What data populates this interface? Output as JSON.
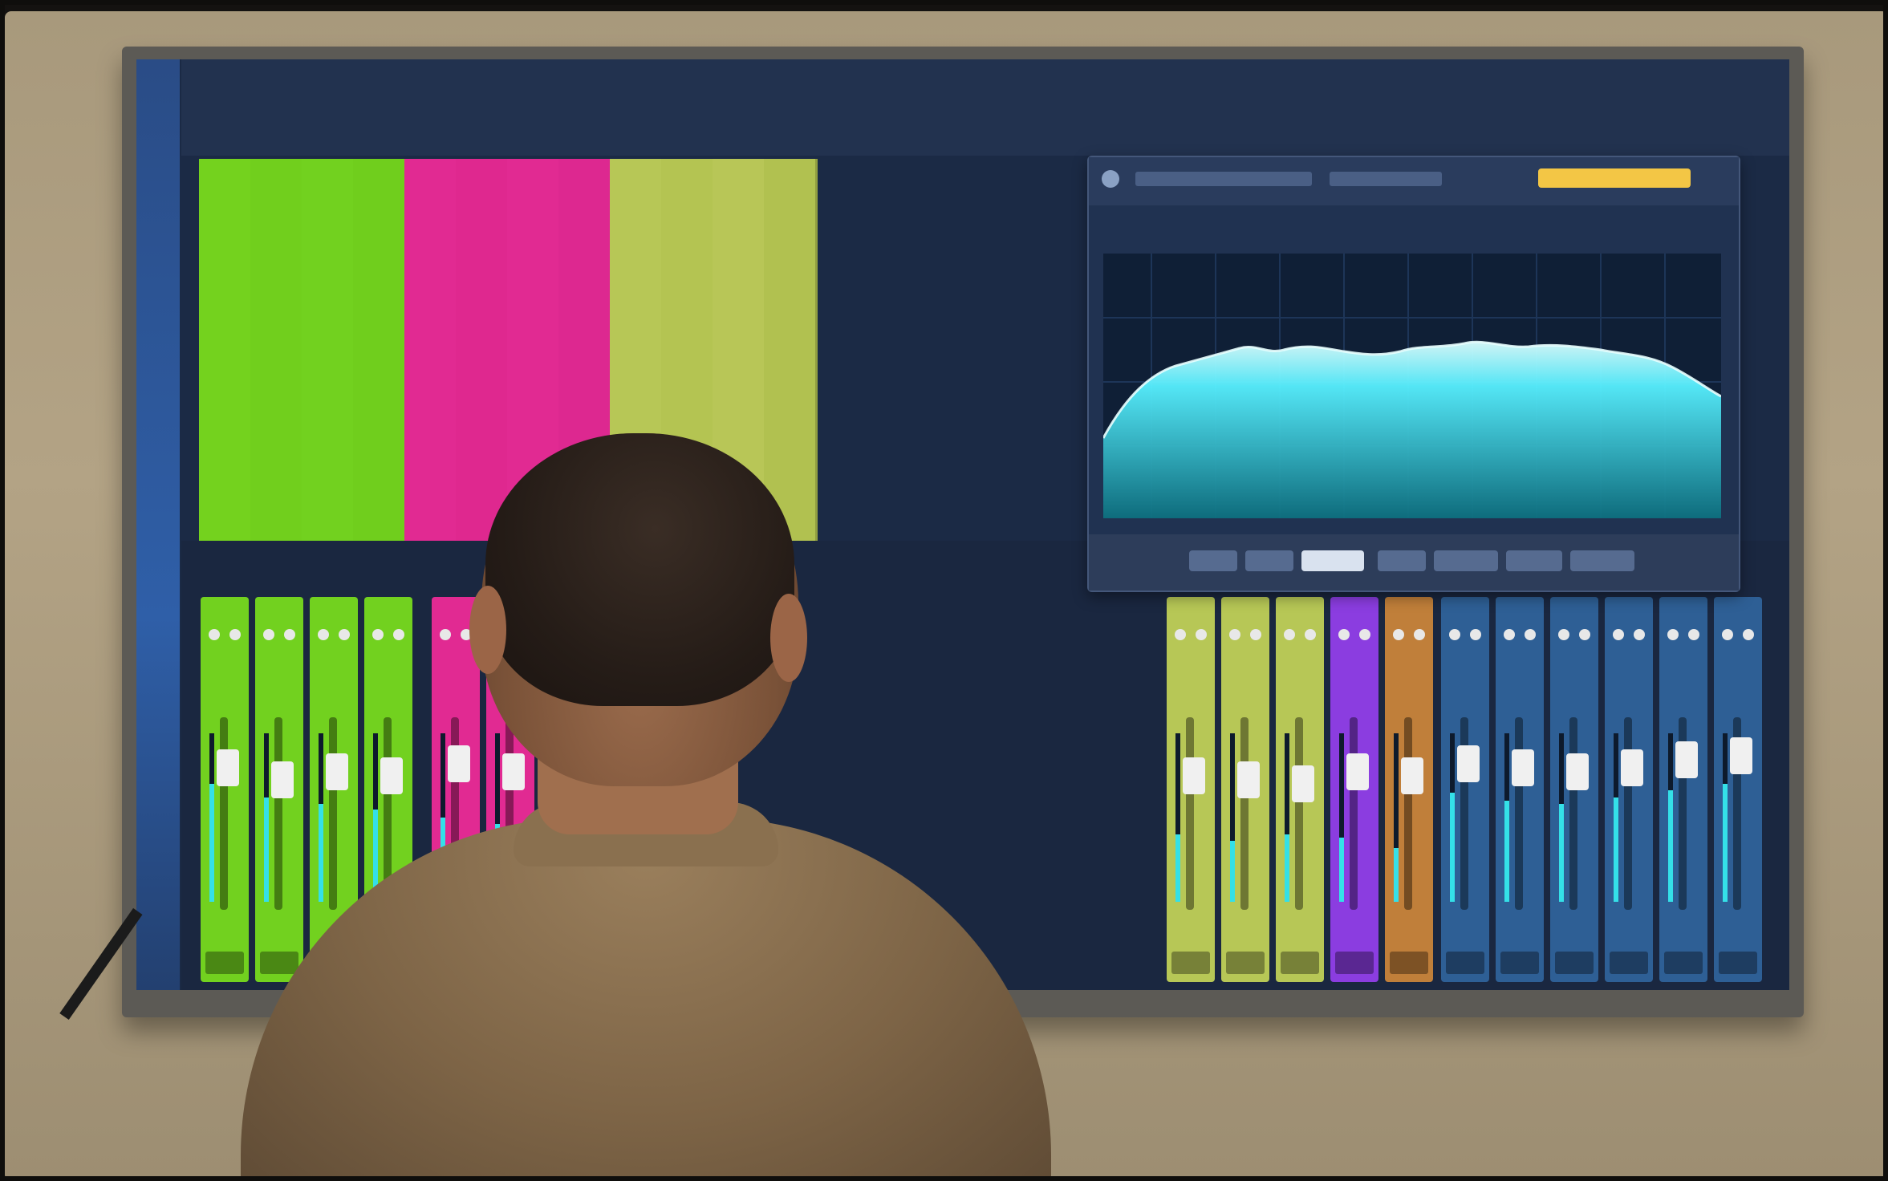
{
  "scene": {
    "description_hidden": "",
    "colors": {
      "wall": "#a8997c",
      "monitor_bezel": "#5c5a55",
      "screen_bg": "#1b2a45",
      "track_green": "#72d11f",
      "track_magenta": "#e12a92",
      "track_olive": "#b7c756",
      "track_purple": "#8b3de0",
      "track_orange": "#c07f3a",
      "track_blue": "#2e5f95",
      "meter": "#34e0e8",
      "spectrum_fill": "#2ad0d8"
    },
    "icons": {
      "plugin_close": "close-icon",
      "meter": "level-meter-icon",
      "knob": "knob-icon"
    }
  }
}
